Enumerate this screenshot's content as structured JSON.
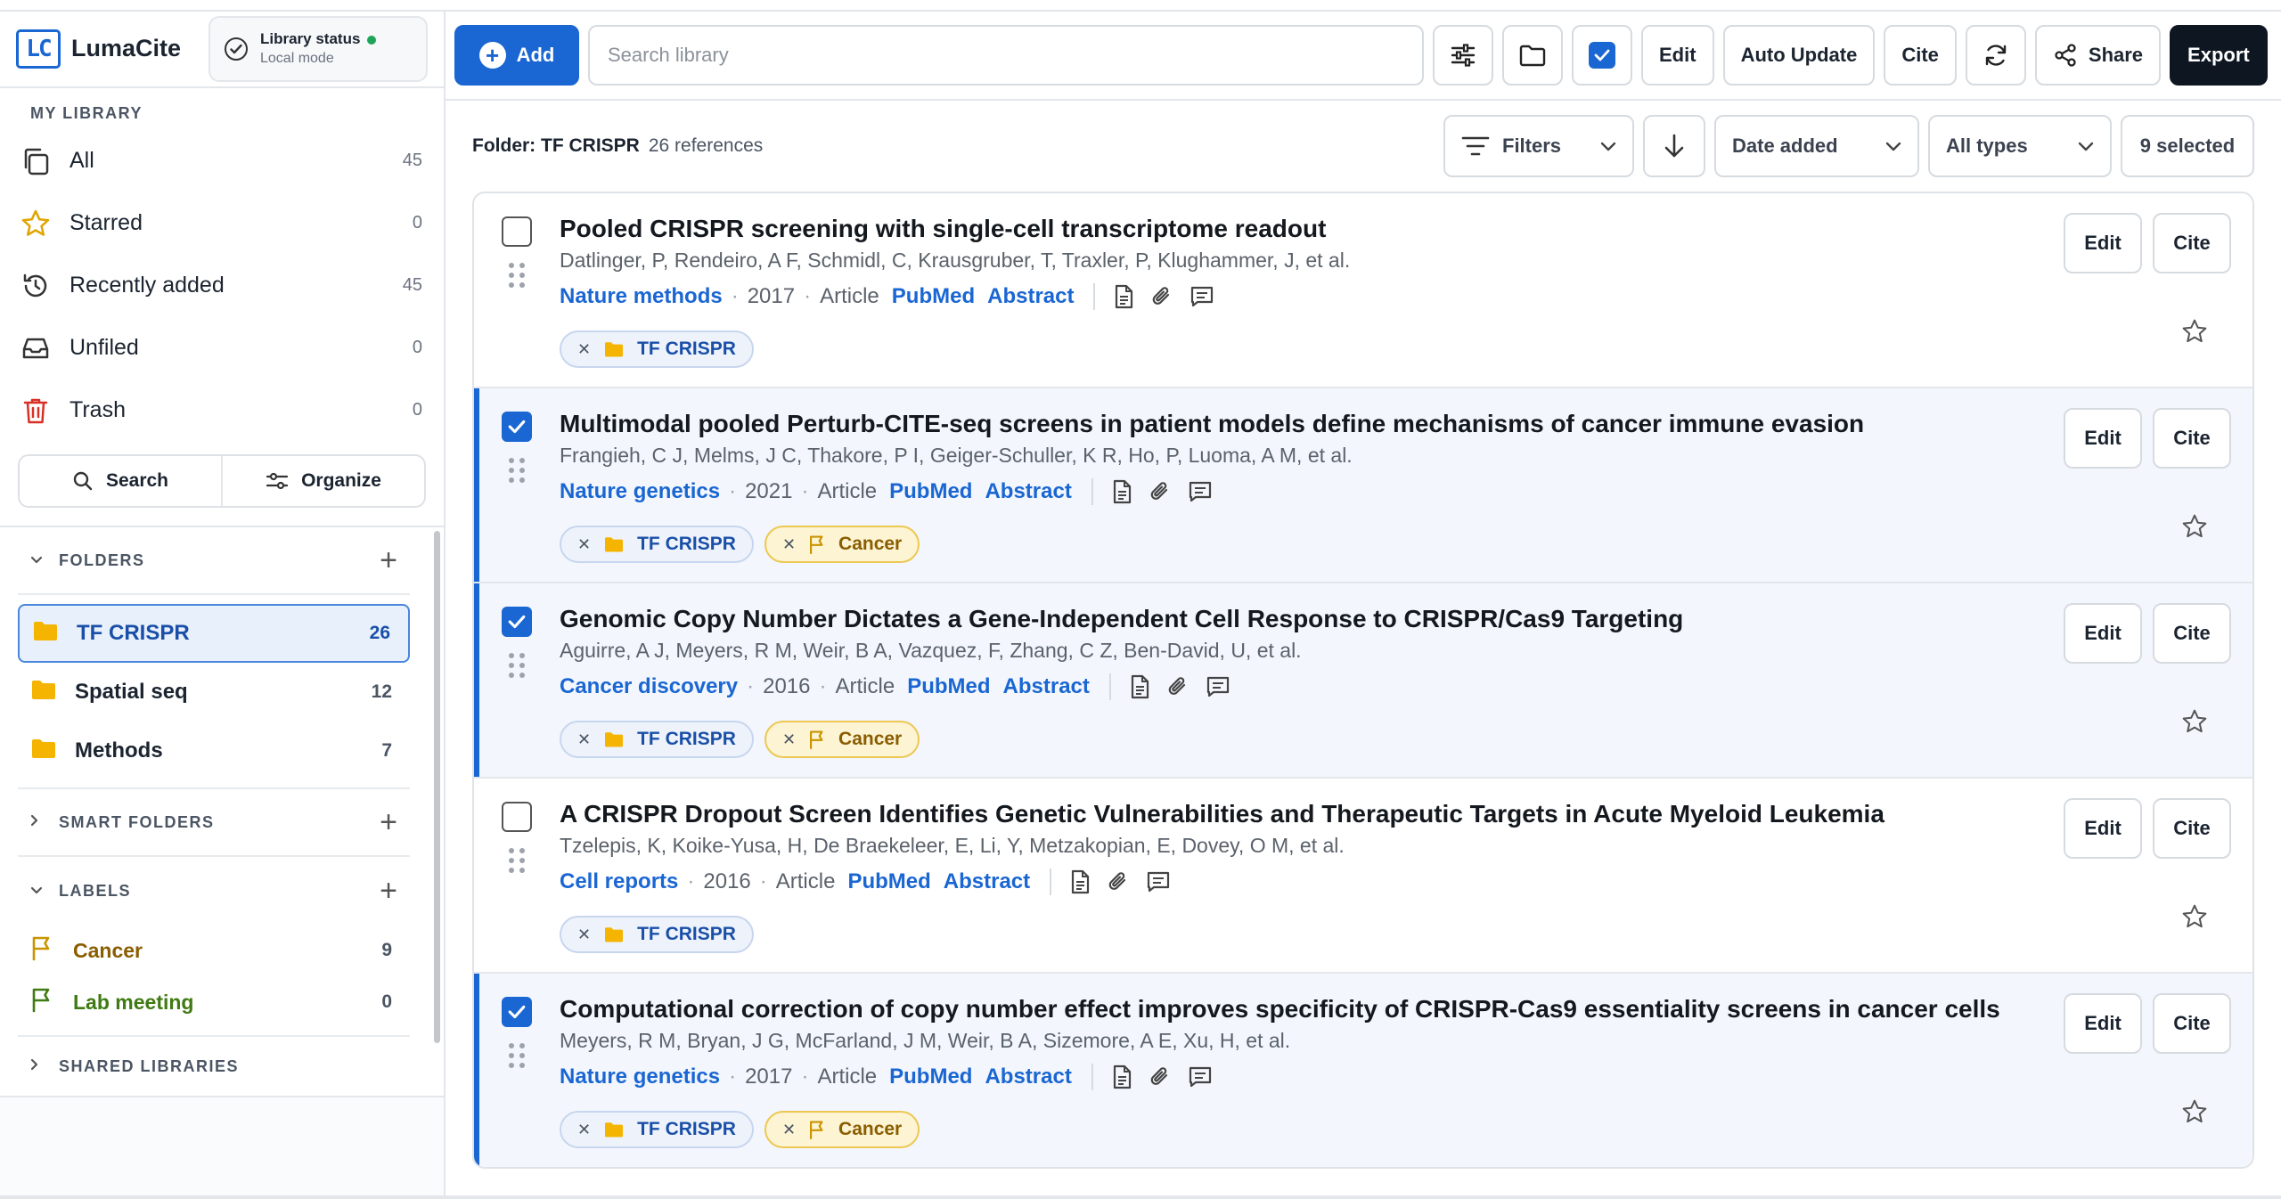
{
  "app": {
    "name": "LumaCite",
    "logo_text": "LC"
  },
  "status": {
    "title": "Library status",
    "mode": "Local mode"
  },
  "my_library": {
    "label": "MY LIBRARY",
    "items": [
      {
        "label": "All",
        "count": "45"
      },
      {
        "label": "Starred",
        "count": "0"
      },
      {
        "label": "Recently added",
        "count": "45"
      },
      {
        "label": "Unfiled",
        "count": "0"
      },
      {
        "label": "Trash",
        "count": "0"
      }
    ]
  },
  "sidebar_actions": {
    "search": "Search",
    "organize": "Organize"
  },
  "folders": {
    "label": "FOLDERS",
    "items": [
      {
        "name": "TF CRISPR",
        "count": "26"
      },
      {
        "name": "Spatial seq",
        "count": "12"
      },
      {
        "name": "Methods",
        "count": "7"
      }
    ]
  },
  "smart_folders": {
    "label": "SMART FOLDERS"
  },
  "labels": {
    "label": "LABELS",
    "items": [
      {
        "name": "Cancer",
        "count": "9",
        "color": "#8a5d00"
      },
      {
        "name": "Lab meeting",
        "count": "0",
        "color": "#3f7a12"
      }
    ]
  },
  "shared": {
    "label": "SHARED LIBRARIES"
  },
  "toolbar": {
    "add": "Add",
    "search_placeholder": "Search library",
    "edit": "Edit",
    "auto_update": "Auto Update",
    "cite": "Cite",
    "share": "Share",
    "export": "Export"
  },
  "subbar": {
    "folder_label": "Folder: TF CRISPR",
    "refs": "26 references",
    "filters": "Filters",
    "sort": "Date added",
    "types": "All types",
    "selected": "9 selected"
  },
  "row_actions": {
    "edit": "Edit",
    "cite": "Cite"
  },
  "references": [
    {
      "title": "Pooled CRISPR screening with single-cell transcriptome readout",
      "authors": "Datlinger, P, Rendeiro, A F, Schmidl, C, Krausgruber, T, Traxler, P, Klughammer, J, et al.",
      "journal": "Nature methods",
      "year": "2017",
      "type": "Article",
      "pubmed": "PubMed",
      "abstract": "Abstract",
      "folder_tag": "TF CRISPR",
      "label_tag": ""
    },
    {
      "title": "Multimodal pooled Perturb-CITE-seq screens in patient models define mechanisms of cancer immune evasion",
      "authors": "Frangieh, C J, Melms, J C, Thakore, P I, Geiger-Schuller, K R, Ho, P, Luoma, A M, et al.",
      "journal": "Nature genetics",
      "year": "2021",
      "type": "Article",
      "pubmed": "PubMed",
      "abstract": "Abstract",
      "folder_tag": "TF CRISPR",
      "label_tag": "Cancer"
    },
    {
      "title": "Genomic Copy Number Dictates a Gene-Independent Cell Response to CRISPR/Cas9 Targeting",
      "authors": "Aguirre, A J, Meyers, R M, Weir, B A, Vazquez, F, Zhang, C Z, Ben-David, U, et al.",
      "journal": "Cancer discovery",
      "year": "2016",
      "type": "Article",
      "pubmed": "PubMed",
      "abstract": "Abstract",
      "folder_tag": "TF CRISPR",
      "label_tag": "Cancer"
    },
    {
      "title": "A CRISPR Dropout Screen Identifies Genetic Vulnerabilities and Therapeutic Targets in Acute Myeloid Leukemia",
      "authors": "Tzelepis, K, Koike-Yusa, H, De Braekeleer, E, Li, Y, Metzakopian, E, Dovey, O M, et al.",
      "journal": "Cell reports",
      "year": "2016",
      "type": "Article",
      "pubmed": "PubMed",
      "abstract": "Abstract",
      "folder_tag": "TF CRISPR",
      "label_tag": ""
    },
    {
      "title": "Computational correction of copy number effect improves specificity of CRISPR-Cas9 essentiality screens in cancer cells",
      "authors": "Meyers, R M, Bryan, J G, McFarland, J M, Weir, B A, Sizemore, A E, Xu, H, et al.",
      "journal": "Nature genetics",
      "year": "2017",
      "type": "Article",
      "pubmed": "PubMed",
      "abstract": "Abstract",
      "folder_tag": "TF CRISPR",
      "label_tag": "Cancer"
    }
  ],
  "colors": {
    "accent": "#1a66d2",
    "folder": "#f4b400",
    "trash": "#d93025",
    "label_cancer": "#c99400",
    "label_lab": "#3f7a12"
  }
}
